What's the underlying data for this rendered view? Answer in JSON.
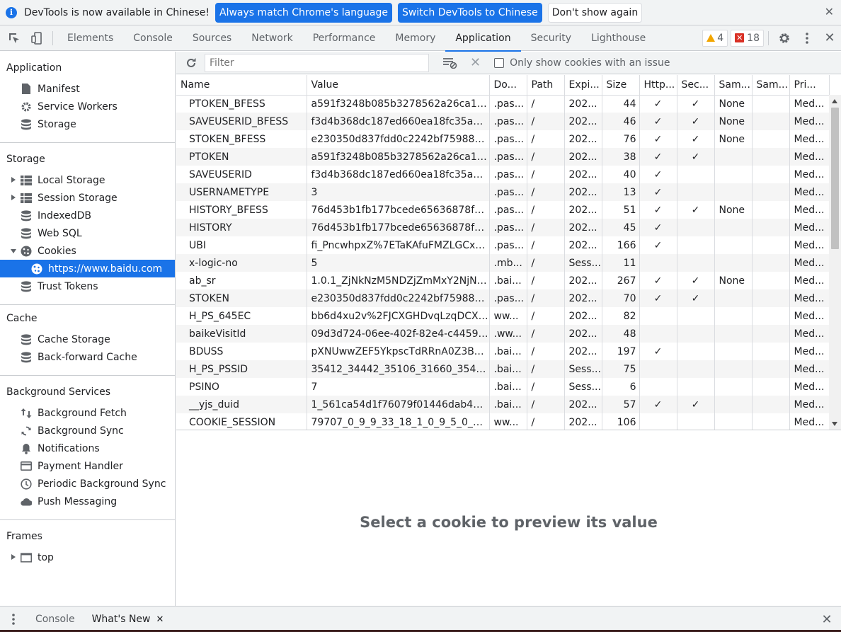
{
  "infobar": {
    "message": "DevTools is now available in Chinese!",
    "btn_match": "Always match Chrome's language",
    "btn_switch": "Switch DevTools to Chinese",
    "btn_dismiss": "Don't show again",
    "close": "✕"
  },
  "toolbar": {
    "tabs": [
      "Elements",
      "Console",
      "Sources",
      "Network",
      "Performance",
      "Memory",
      "Application",
      "Security",
      "Lighthouse"
    ],
    "active_tab": "Application",
    "warnings": "4",
    "errors": "18",
    "error_glyph": "✕",
    "close": "✕"
  },
  "sidebar": {
    "application": {
      "title": "Application",
      "items": [
        "Manifest",
        "Service Workers",
        "Storage"
      ]
    },
    "storage": {
      "title": "Storage",
      "items": [
        "Local Storage",
        "Session Storage",
        "IndexedDB",
        "Web SQL",
        "Cookies",
        "https://www.baidu.com",
        "Trust Tokens"
      ]
    },
    "cache": {
      "title": "Cache",
      "items": [
        "Cache Storage",
        "Back-forward Cache"
      ]
    },
    "background": {
      "title": "Background Services",
      "items": [
        "Background Fetch",
        "Background Sync",
        "Notifications",
        "Payment Handler",
        "Periodic Background Sync",
        "Push Messaging"
      ]
    },
    "frames": {
      "title": "Frames",
      "items": [
        "top"
      ]
    }
  },
  "filterbar": {
    "placeholder": "Filter",
    "clear": "✕",
    "only_issues_label": "Only show cookies with an issue"
  },
  "cookies": {
    "columns": [
      "Name",
      "Value",
      "Do...",
      "Path",
      "Expi...",
      "Size",
      "Http...",
      "Sec...",
      "Sam...",
      "Sam...",
      "Pri..."
    ],
    "rows": [
      [
        "PTOKEN_BFESS",
        "a591f3248b085b3278562a26ca170...",
        ".pas...",
        "/",
        "202...",
        "44",
        "✓",
        "✓",
        "None",
        "",
        "Med..."
      ],
      [
        "SAVEUSERID_BFESS",
        "f3d4b368dc187ed660ea18fc35a952",
        ".pas...",
        "/",
        "202...",
        "46",
        "✓",
        "✓",
        "None",
        "",
        "Med..."
      ],
      [
        "STOKEN_BFESS",
        "e230350d837fdd0c2242bf75988d0...",
        ".pas...",
        "/",
        "202...",
        "76",
        "✓",
        "✓",
        "None",
        "",
        "Med..."
      ],
      [
        "PTOKEN",
        "a591f3248b085b3278562a26ca170...",
        ".pas...",
        "/",
        "202...",
        "38",
        "✓",
        "✓",
        "",
        "",
        "Med..."
      ],
      [
        "SAVEUSERID",
        "f3d4b368dc187ed660ea18fc35a952",
        ".pas...",
        "/",
        "202...",
        "40",
        "✓",
        "",
        "",
        "",
        "Med..."
      ],
      [
        "USERNAMETYPE",
        "3",
        ".pas...",
        "/",
        "202...",
        "13",
        "✓",
        "",
        "",
        "",
        "Med..."
      ],
      [
        "HISTORY_BFESS",
        "76d453b1fb177bcede65636878f6af...",
        ".pas...",
        "/",
        "202...",
        "51",
        "✓",
        "✓",
        "None",
        "",
        "Med..."
      ],
      [
        "HISTORY",
        "76d453b1fb177bcede65636878f6af...",
        ".pas...",
        "/",
        "202...",
        "45",
        "✓",
        "",
        "",
        "",
        "Med..."
      ],
      [
        "UBI",
        "fi_PncwhpxZ%7ETaKAfuFMZLGCxYv...",
        ".pas...",
        "/",
        "202...",
        "166",
        "✓",
        "",
        "",
        "",
        "Med..."
      ],
      [
        "x-logic-no",
        "5",
        ".mb...",
        "/",
        "Sess...",
        "11",
        "",
        "",
        "",
        "",
        "Med..."
      ],
      [
        "ab_sr",
        "1.0.1_ZjNkNzM5NDZjZmMxY2NjNG...",
        ".bai...",
        "/",
        "202...",
        "267",
        "✓",
        "✓",
        "None",
        "",
        "Med..."
      ],
      [
        "STOKEN",
        "e230350d837fdd0c2242bf75988d0...",
        ".pas...",
        "/",
        "202...",
        "70",
        "✓",
        "✓",
        "",
        "",
        "Med..."
      ],
      [
        "H_PS_645EC",
        "bb6d4xu2v%2FJCXGHDvqLzqDCXg...",
        "ww...",
        "/",
        "202...",
        "82",
        "",
        "",
        "",
        "",
        "Med..."
      ],
      [
        "baikeVisitId",
        "09d3d724-06ee-402f-82e4-c4459af...",
        ".ww...",
        "/",
        "202...",
        "48",
        "",
        "",
        "",
        "",
        "Med..."
      ],
      [
        "BDUSS",
        "pXNUwwZEF5YkpscTdRRnA0Z3BSM...",
        ".bai...",
        "/",
        "202...",
        "197",
        "✓",
        "",
        "",
        "",
        "Med..."
      ],
      [
        "H_PS_PSSID",
        "35412_34442_35106_31660_35456_...",
        ".bai...",
        "/",
        "Sess...",
        "75",
        "",
        "",
        "",
        "",
        "Med..."
      ],
      [
        "PSINO",
        "7",
        ".bai...",
        "/",
        "Sess...",
        "6",
        "",
        "",
        "",
        "",
        "Med..."
      ],
      [
        "__yjs_duid",
        "1_561ca54d1f76079f01446dab499a...",
        ".bai...",
        "/",
        "202...",
        "57",
        "✓",
        "✓",
        "",
        "",
        "Med..."
      ],
      [
        "COOKIE_SESSION",
        "79707_0_9_9_33_18_1_0_9_5_0_8_79...",
        "ww...",
        "/",
        "202...",
        "106",
        "",
        "",
        "",
        "",
        "Med..."
      ]
    ]
  },
  "preview": {
    "message": "Select a cookie to preview its value"
  },
  "drawer": {
    "tabs": [
      "Console",
      "What's New"
    ],
    "active_tab": "What's New",
    "tab_close": "✕",
    "close": "✕"
  },
  "colors": {
    "accent": "#1a73e8",
    "warning": "#f2a600",
    "error": "#d93025"
  }
}
